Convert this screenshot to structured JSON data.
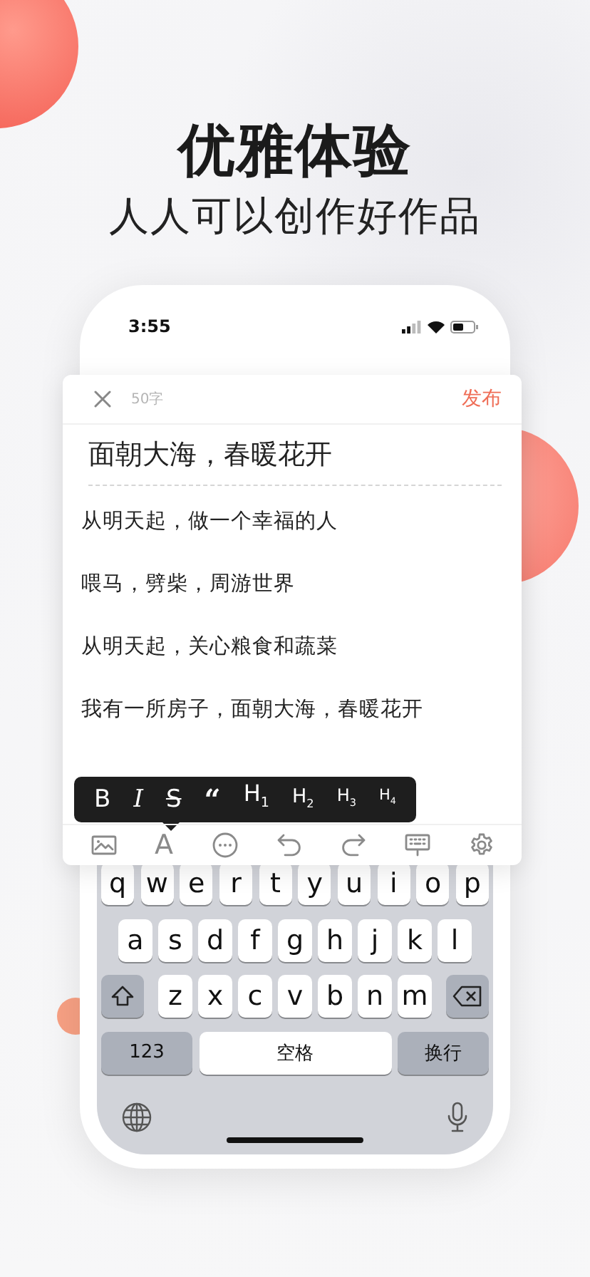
{
  "headline": {
    "title": "优雅体验",
    "subtitle": "人人可以创作好作品"
  },
  "status_bar": {
    "time": "3:55"
  },
  "editor": {
    "word_count": "50字",
    "publish": "发布",
    "title": "面朝大海，春暖花开",
    "paragraphs": [
      "从明天起，做一个幸福的人",
      "喂马，劈柴，周游世界",
      "从明天起，关心粮食和蔬菜",
      "我有一所房子，面朝大海，春暖花开"
    ]
  },
  "format_menu": [
    {
      "label": "B",
      "kind": "bold"
    },
    {
      "label": "I",
      "kind": "italic"
    },
    {
      "label": "S",
      "kind": "strike"
    },
    {
      "label": "“",
      "kind": "quote"
    },
    {
      "label": "H$_{1}$",
      "kind": "h1"
    },
    {
      "label": "H$_{2}$",
      "kind": "h2"
    },
    {
      "label": "H$_{3}$",
      "kind": "h3"
    },
    {
      "label": "H$_{4}$",
      "kind": "h4"
    }
  ],
  "toolbar": [
    {
      "kind": "image"
    },
    {
      "kind": "font",
      "label": "A"
    },
    {
      "kind": "more"
    },
    {
      "kind": "undo"
    },
    {
      "kind": "redo"
    },
    {
      "kind": "keyboard"
    },
    {
      "kind": "settings"
    }
  ],
  "keyboard": {
    "top_letters": [
      {
        "kind": "letter",
        "label": "q"
      },
      {
        "kind": "letter",
        "label": "w"
      },
      {
        "kind": "letter",
        "label": "e"
      },
      {
        "kind": "letter",
        "label": "r"
      },
      {
        "kind": "letter",
        "label": "t"
      },
      {
        "kind": "letter",
        "label": "y"
      },
      {
        "kind": "letter",
        "label": "u"
      },
      {
        "kind": "letter",
        "label": "i"
      },
      {
        "kind": "letter",
        "label": "o"
      },
      {
        "kind": "letter",
        "label": "p"
      }
    ],
    "middle_letters": [
      {
        "kind": "letter",
        "label": "a"
      },
      {
        "kind": "letter",
        "label": "s"
      },
      {
        "kind": "letter",
        "label": "d"
      },
      {
        "kind": "letter",
        "label": "f"
      },
      {
        "kind": "letter",
        "label": "g"
      },
      {
        "kind": "letter",
        "label": "h"
      },
      {
        "kind": "letter",
        "label": "j"
      },
      {
        "kind": "letter",
        "label": "k"
      },
      {
        "kind": "letter",
        "label": "l"
      }
    ],
    "bottom_letters": [
      {
        "kind": "shift"
      },
      {
        "kind": "letter",
        "label": "z"
      },
      {
        "kind": "letter",
        "label": "x"
      },
      {
        "kind": "letter",
        "label": "c"
      },
      {
        "kind": "letter",
        "label": "v"
      },
      {
        "kind": "letter",
        "label": "b"
      },
      {
        "kind": "letter",
        "label": "n"
      },
      {
        "kind": "letter",
        "label": "m"
      },
      {
        "kind": "delete"
      }
    ],
    "function_keys": [
      {
        "kind": "mode",
        "label": "123"
      },
      {
        "kind": "space",
        "label": "空格"
      },
      {
        "kind": "return",
        "label": "换行"
      }
    ],
    "icons": [
      {
        "kind": "globe"
      },
      {
        "kind": "mic"
      }
    ]
  }
}
